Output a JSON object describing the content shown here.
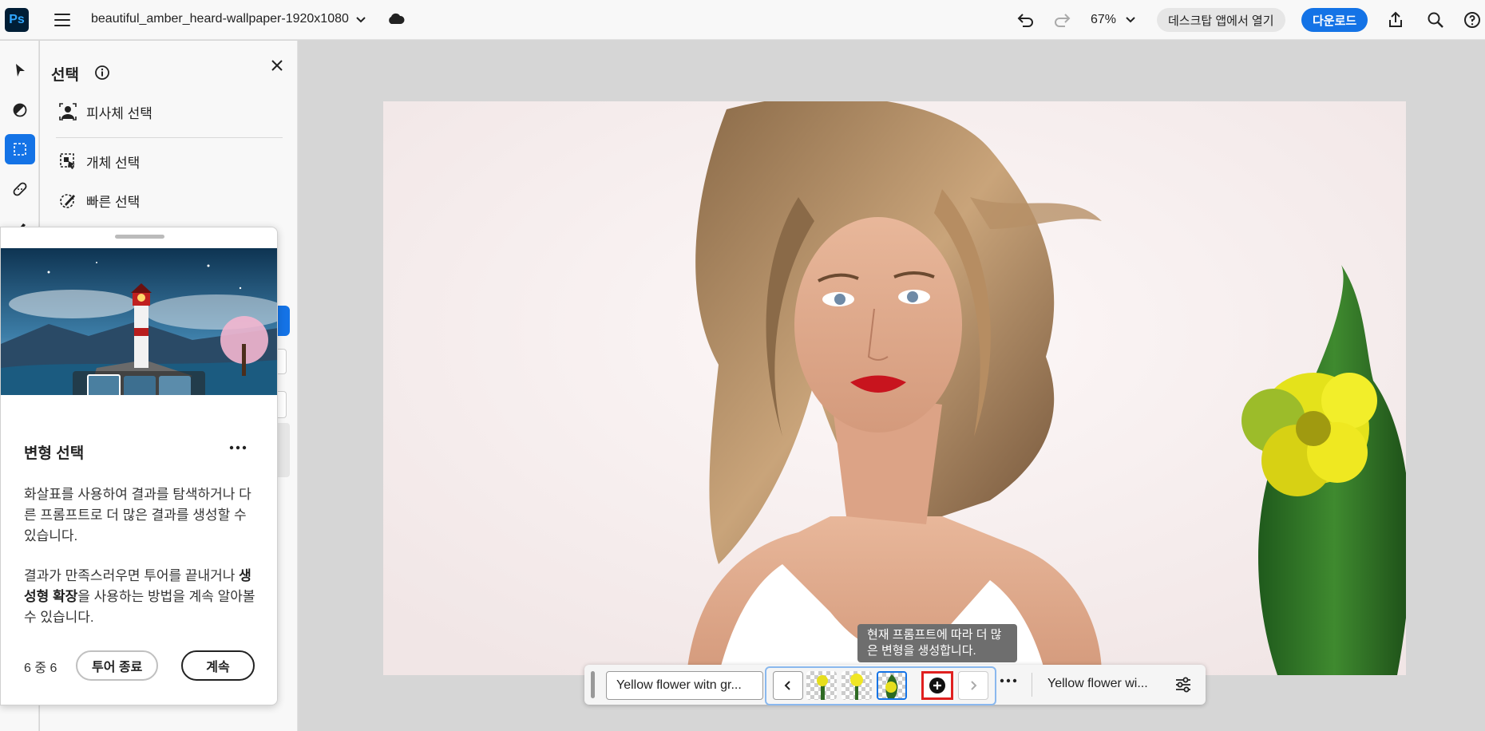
{
  "app": {
    "logo": "Ps",
    "document_title": "beautiful_amber_heard-wallpaper-1920x1080"
  },
  "topbar": {
    "zoom": "67%",
    "open_desktop_label": "데스크탑 앱에서 열기",
    "download_label": "다운로드"
  },
  "panel": {
    "title": "선택",
    "items": [
      {
        "label": "피사체 선택",
        "icon": "subject-select-icon"
      },
      {
        "label": "개체 선택",
        "icon": "object-select-icon"
      },
      {
        "label": "빠른 선택",
        "icon": "quick-select-icon"
      }
    ]
  },
  "tour": {
    "heading": "변형 선택",
    "body1": "화살표를 사용하여 결과를 탐색하거나 다른 프롬프트로 더 많은 결과를 생성할 수 있습니다.",
    "body2_prefix": "결과가 만족스러우면 투어를 끝내거나 ",
    "body2_bold": "생성형 확장",
    "body2_suffix": "을 사용하는 방법을 계속 알아볼 수 있습니다.",
    "step": "6 중 6",
    "end_label": "투어 종료",
    "next_label": "계속"
  },
  "taskbar": {
    "prompt_value": "Yellow flower witn gr...",
    "result_label": "Yellow flower wi...",
    "tooltip": "현재 프롬프트에 따라 더 많은 변형을 생성합니다."
  },
  "colors": {
    "accent": "#1473e6",
    "highlight": "#e0201f",
    "ps_bg": "#001e36",
    "ps_text": "#31a8ff"
  }
}
